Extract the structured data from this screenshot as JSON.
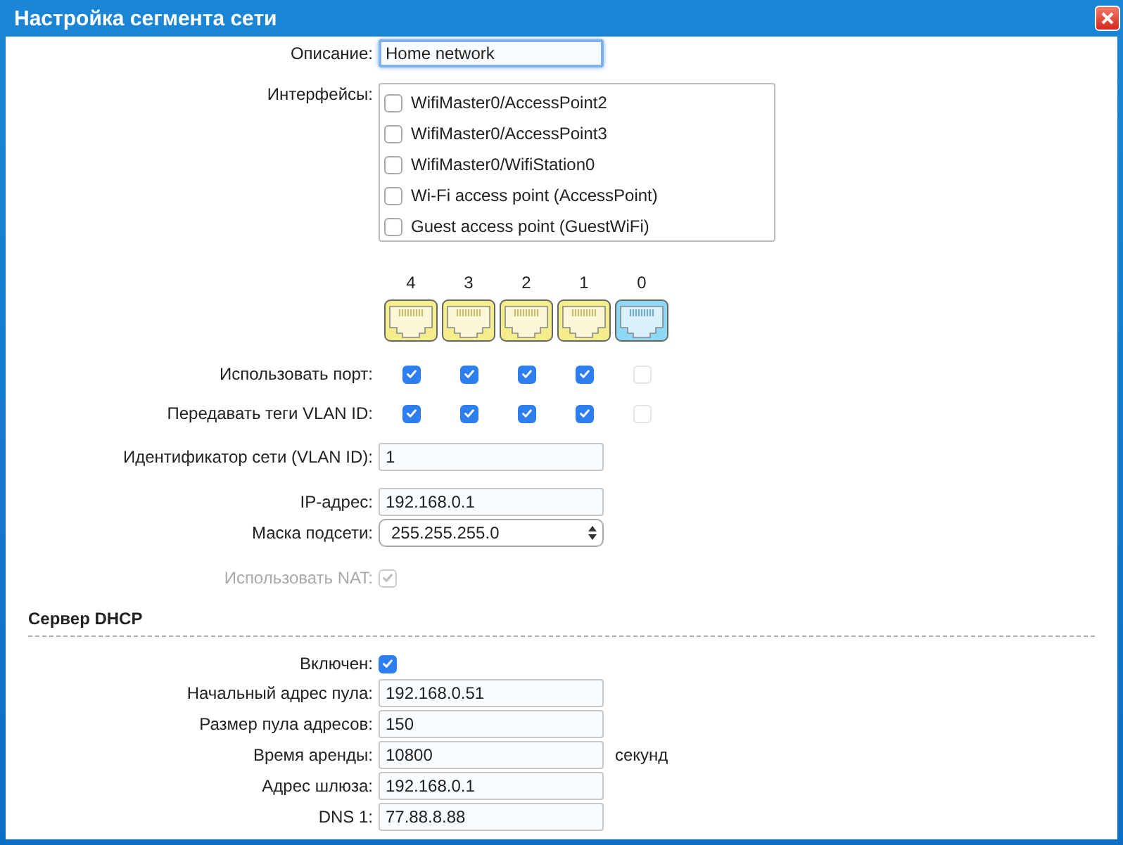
{
  "window": {
    "title": "Настройка сегмента сети"
  },
  "description": {
    "label": "Описание:",
    "value": "Home network",
    "focused": true
  },
  "interfaces": {
    "label": "Интерфейсы:",
    "items": [
      {
        "label": "WifiMaster0/AccessPoint2",
        "checked": false
      },
      {
        "label": "WifiMaster0/AccessPoint3",
        "checked": false
      },
      {
        "label": "WifiMaster0/WifiStation0",
        "checked": false
      },
      {
        "label": "Wi-Fi access point (AccessPoint)",
        "checked": false
      },
      {
        "label": "Guest access point (GuestWiFi)",
        "checked": false
      }
    ]
  },
  "ports": {
    "use_label": "Использовать порт:",
    "tag_label": "Передавать теги VLAN ID:",
    "items": [
      {
        "number": "4",
        "color": "#f5ec8c",
        "use": true,
        "tag": true,
        "disabled": false
      },
      {
        "number": "3",
        "color": "#f5ec8c",
        "use": true,
        "tag": true,
        "disabled": false
      },
      {
        "number": "2",
        "color": "#f5ec8c",
        "use": true,
        "tag": true,
        "disabled": false
      },
      {
        "number": "1",
        "color": "#f5ec8c",
        "use": true,
        "tag": true,
        "disabled": false
      },
      {
        "number": "0",
        "color": "#8fd8f5",
        "use": false,
        "tag": false,
        "disabled": true
      }
    ]
  },
  "vlan_id": {
    "label": "Идентификатор сети (VLAN ID):",
    "value": "1"
  },
  "ip": {
    "label": "IP-адрес:",
    "value": "192.168.0.1"
  },
  "mask": {
    "label": "Маска подсети:",
    "value": "255.255.255.0"
  },
  "nat": {
    "label": "Использовать NAT:",
    "checked": true,
    "disabled": true
  },
  "dhcp": {
    "title": "Сервер DHCP",
    "enabled": {
      "label": "Включен:",
      "checked": true
    },
    "fields": [
      {
        "label": "Начальный адрес пула:",
        "value": "192.168.0.51"
      },
      {
        "label": "Размер пула адресов:",
        "value": "150"
      },
      {
        "label": "Время аренды:",
        "value": "10800",
        "unit": "секунд"
      },
      {
        "label": "Адрес шлюза:",
        "value": "192.168.0.1"
      },
      {
        "label": "DNS 1:",
        "value": "77.88.8.88"
      }
    ]
  }
}
